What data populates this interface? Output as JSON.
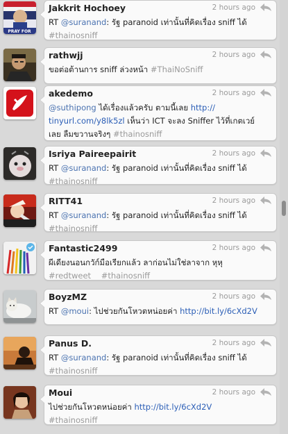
{
  "timeline": {
    "tweets": [
      {
        "user": "Jakkrit Hochoey",
        "time": "2 hours ago",
        "avatar": "flag-avatar",
        "avatar_text": "PRAY FOR",
        "lines": [
          [
            {
              "t": "RT ",
              "k": "plain"
            },
            {
              "t": "@suranand",
              "k": "mention"
            },
            {
              "t": ": รัฐ paranoid เท่านั้นที่คิดเรื่อง sniff ได้",
              "k": "plain"
            }
          ],
          [
            {
              "t": "#thainosniff",
              "k": "hashtag"
            }
          ]
        ]
      },
      {
        "user": "rathwjj",
        "time": "2 hours ago",
        "avatar": "man-avatar",
        "lines": [
          [
            {
              "t": "ขอต่อต้านการ sniff ล่วงหน้า ",
              "k": "plain"
            },
            {
              "t": "#ThaiNoSniff",
              "k": "hashtag"
            }
          ]
        ]
      },
      {
        "user": "akedemo",
        "time": "2 hours ago",
        "avatar": "red-app-avatar",
        "lines": [
          [
            {
              "t": "@suthipong",
              "k": "mention"
            },
            {
              "t": " ได้เรื่องแล้วครับ ตามนี้เลย ",
              "k": "plain"
            },
            {
              "t": "http://",
              "k": "link"
            }
          ],
          [
            {
              "t": "tinyurl.com/y8lk5zl",
              "k": "link"
            },
            {
              "t": " เห็นว่า ICT จะลง Sniffer ไว้ที่เกตเวย์",
              "k": "plain"
            }
          ],
          [
            {
              "t": "เลย ลืมขวานจริงๆ ",
              "k": "plain"
            },
            {
              "t": "#thainosniff",
              "k": "hashtag"
            }
          ]
        ]
      },
      {
        "user": "Isriya Paireepairit",
        "time": "2 hours ago",
        "avatar": "toy-avatar",
        "lines": [
          [
            {
              "t": "RT ",
              "k": "plain"
            },
            {
              "t": "@suranand",
              "k": "mention"
            },
            {
              "t": ": รัฐ paranoid เท่านั้นที่คิดเรื่อง sniff ได้",
              "k": "plain"
            }
          ],
          [
            {
              "t": "#thainosniff",
              "k": "hashtag"
            }
          ]
        ]
      },
      {
        "user": "RITT41",
        "time": "2 hours ago",
        "avatar": "anime-avatar",
        "lines": [
          [
            {
              "t": "RT ",
              "k": "plain"
            },
            {
              "t": "@suranand",
              "k": "mention"
            },
            {
              "t": ": รัฐ paranoid เท่านั้นที่คิดเรื่อง sniff ได้",
              "k": "plain"
            }
          ],
          [
            {
              "t": "#thainosniff",
              "k": "hashtag"
            }
          ]
        ]
      },
      {
        "user": "Fantastic2499",
        "time": "2 hours ago",
        "avatar": "pencils-avatar",
        "lines": [
          [
            {
              "t": "ผีเดียงนอนกวัก์มือเรียกแล้ว ลาก่อนไม่ใช่ลาจาก หุหุ",
              "k": "plain"
            }
          ],
          [
            {
              "t": "#redtweet",
              "k": "hashtag"
            },
            {
              "t": "    ",
              "k": "plain"
            },
            {
              "t": "#thainosniff",
              "k": "hashtag"
            }
          ]
        ]
      },
      {
        "user": "BoyzMZ",
        "time": "2 hours ago",
        "avatar": "cat-avatar",
        "lines": [
          [
            {
              "t": "RT ",
              "k": "plain"
            },
            {
              "t": "@moui",
              "k": "mention"
            },
            {
              "t": ": ไปช่วยกันโหวตหน่อยค่า ",
              "k": "plain"
            },
            {
              "t": "http://bit.ly/6cXd2V",
              "k": "link"
            }
          ]
        ]
      },
      {
        "user": "Panus D.",
        "time": "2 hours ago",
        "avatar": "silhouette-avatar",
        "lines": [
          [
            {
              "t": "RT ",
              "k": "plain"
            },
            {
              "t": "@suranand",
              "k": "mention"
            },
            {
              "t": ": รัฐ paranoid เท่านั้นที่คิดเรื่อง sniff ได้",
              "k": "plain"
            }
          ],
          [
            {
              "t": "#thainosniff",
              "k": "hashtag"
            }
          ]
        ]
      },
      {
        "user": "Moui",
        "time": "2 hours ago",
        "avatar": "woman-avatar",
        "lines": [
          [
            {
              "t": "ไปช่วยกันโหวตหน่อยค่า ",
              "k": "plain"
            },
            {
              "t": "http://bit.ly/6cXd2V",
              "k": "link"
            }
          ],
          [
            {
              "t": "#thainosniff",
              "k": "hashtag"
            }
          ]
        ]
      }
    ]
  }
}
